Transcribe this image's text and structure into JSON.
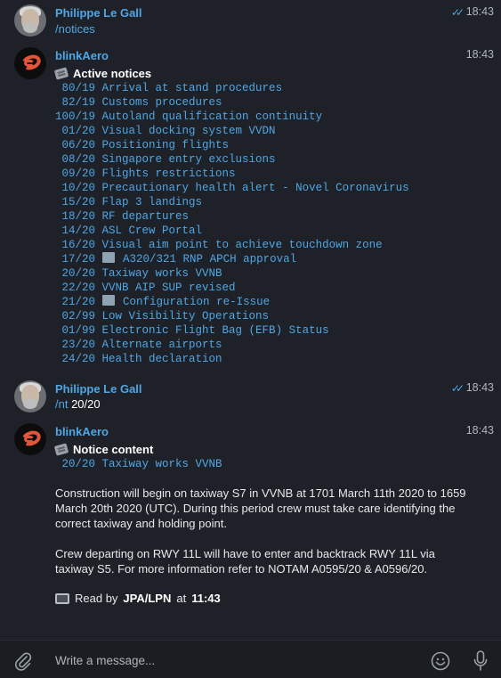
{
  "messages": [
    {
      "sender": "Philippe Le Gall",
      "time": "18:43",
      "read": true,
      "command": "/notices",
      "args": ""
    },
    {
      "sender": "blinkAero",
      "time": "18:43",
      "heading": "Active notices",
      "notices": [
        {
          "id": " 80/19",
          "title": "Arrival at stand procedures",
          "icon": ""
        },
        {
          "id": " 82/19",
          "title": "Customs procedures",
          "icon": ""
        },
        {
          "id": "100/19",
          "title": "Autoland qualification continuity",
          "icon": ""
        },
        {
          "id": " 01/20",
          "title": "Visual docking system VVDN",
          "icon": ""
        },
        {
          "id": " 06/20",
          "title": "Positioning flights",
          "icon": ""
        },
        {
          "id": " 08/20",
          "title": "Singapore entry exclusions",
          "icon": ""
        },
        {
          "id": " 09/20",
          "title": "Flights restrictions",
          "icon": ""
        },
        {
          "id": " 10/20",
          "title": "Precautionary health alert - Novel Coronavirus",
          "icon": ""
        },
        {
          "id": " 15/20",
          "title": "Flap 3 landings",
          "icon": ""
        },
        {
          "id": " 18/20",
          "title": "RF departures",
          "icon": ""
        },
        {
          "id": " 14/20",
          "title": "ASL Crew Portal",
          "icon": ""
        },
        {
          "id": " 16/20",
          "title": "Visual aim point to achieve touchdown zone",
          "icon": ""
        },
        {
          "id": " 17/20",
          "title": "A320/321 RNP APCH approval",
          "icon": "map-icon"
        },
        {
          "id": " 20/20",
          "title": "Taxiway works VVNB",
          "icon": ""
        },
        {
          "id": " 22/20",
          "title": "VVNB AIP SUP revised",
          "icon": ""
        },
        {
          "id": " 21/20",
          "title": "Configuration re-Issue",
          "icon": "map-icon"
        },
        {
          "id": " 02/99",
          "title": "Low Visibility Operations",
          "icon": ""
        },
        {
          "id": " 01/99",
          "title": "Electronic Flight Bag (EFB) Status",
          "icon": ""
        },
        {
          "id": " 23/20",
          "title": "Alternate airports",
          "icon": ""
        },
        {
          "id": " 24/20",
          "title": "Health declaration",
          "icon": ""
        }
      ]
    },
    {
      "sender": "Philippe Le Gall",
      "time": "18:43",
      "read": true,
      "command": "/nt",
      "args": " 20/20"
    },
    {
      "sender": "blinkAero",
      "time": "18:43",
      "heading": "Notice content",
      "notice_ref": " 20/20 Taxiway works VVNB",
      "paragraphs": [
        "Construction will begin on taxiway S7 in VVNB at 1701 March 11th 2020 to 1659 March 20th 2020 (UTC). During this period crew must take care identifying the correct taxiway and holding point.",
        "Crew departing on RWY 11L will have to enter and backtrack RWY 11L via taxiway S5. For more information refer to NOTAM A0595/20 & A0596/20."
      ],
      "read_by": {
        "prefix": "Read by",
        "who": "JPA/LPN",
        "at_word": "at",
        "time": "11:43"
      }
    }
  ],
  "composer": {
    "placeholder": "Write a message..."
  },
  "colors": {
    "background": "#1e2228",
    "accent": "#4fa6e5",
    "text": "#e6e8eb",
    "muted": "#b0b5bb"
  }
}
